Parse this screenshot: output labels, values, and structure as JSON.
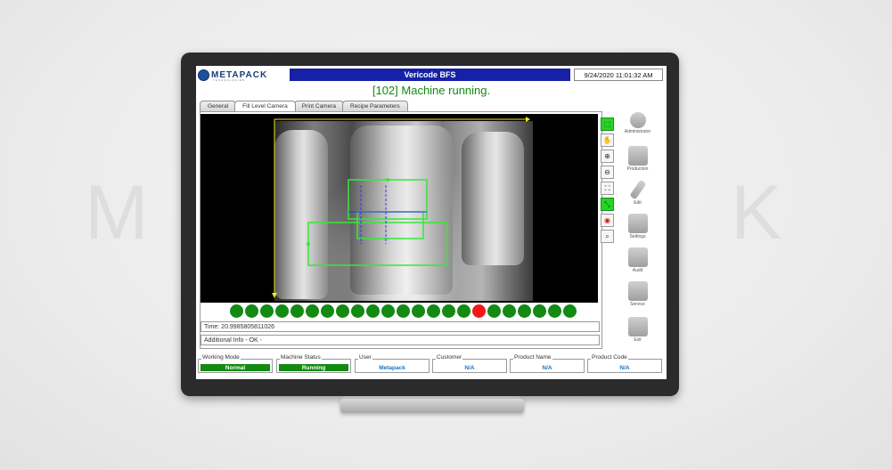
{
  "watermark": {
    "left": "M",
    "right": "K"
  },
  "header": {
    "logo_text": "METAPACK",
    "logo_subtext": "TECHNOLOGIES",
    "title": "Vericode BFS",
    "datetime": "9/24/2020 11:01:32 AM"
  },
  "status_message": "[102] Machine running.",
  "tabs": [
    {
      "label": "General"
    },
    {
      "label": "Fill Level Camera"
    },
    {
      "label": "Print Camera"
    },
    {
      "label": "Recipe Parameters"
    }
  ],
  "tools": [
    {
      "icon": "select-icon"
    },
    {
      "icon": "hand-icon"
    },
    {
      "icon": "zoom-in-icon"
    },
    {
      "icon": "zoom-out-icon"
    },
    {
      "icon": "fit-icon"
    },
    {
      "icon": "resize-icon"
    },
    {
      "icon": "target-icon"
    },
    {
      "icon": "zoom-reset-icon"
    }
  ],
  "dots": {
    "count": 23,
    "red_index": 16,
    "green_color": "#138a12",
    "red_color": "#ee1a1a"
  },
  "info": {
    "time": "Time: 20.9985805811026",
    "additional": "Additional Info - OK -"
  },
  "sidebar": [
    {
      "label": "Administrator",
      "icon": "user-icon"
    },
    {
      "label": "Production",
      "icon": "production-icon"
    },
    {
      "label": "Edit",
      "icon": "pencil-icon"
    },
    {
      "label": "Settings",
      "icon": "settings-icon"
    },
    {
      "label": "Audit",
      "icon": "audit-icon"
    },
    {
      "label": "Service",
      "icon": "service-icon"
    },
    {
      "label": "Exit",
      "icon": "exit-icon"
    }
  ],
  "statusbar": {
    "working_mode": {
      "label": "Working Mode",
      "value": "Normal"
    },
    "machine_status": {
      "label": "Machine Status",
      "value": "Running"
    },
    "user": {
      "label": "User",
      "value": "Metapack"
    },
    "customer": {
      "label": "Customer",
      "value": "N/A"
    },
    "product_name": {
      "label": "Product Name",
      "value": "N/A"
    },
    "product_code": {
      "label": "Product Code",
      "value": "N/A"
    }
  },
  "colors": {
    "title_bar": "#1621a6",
    "status_green": "#138a12",
    "overlay_green": "#39e639",
    "axis_yellow": "#f0e61a"
  }
}
